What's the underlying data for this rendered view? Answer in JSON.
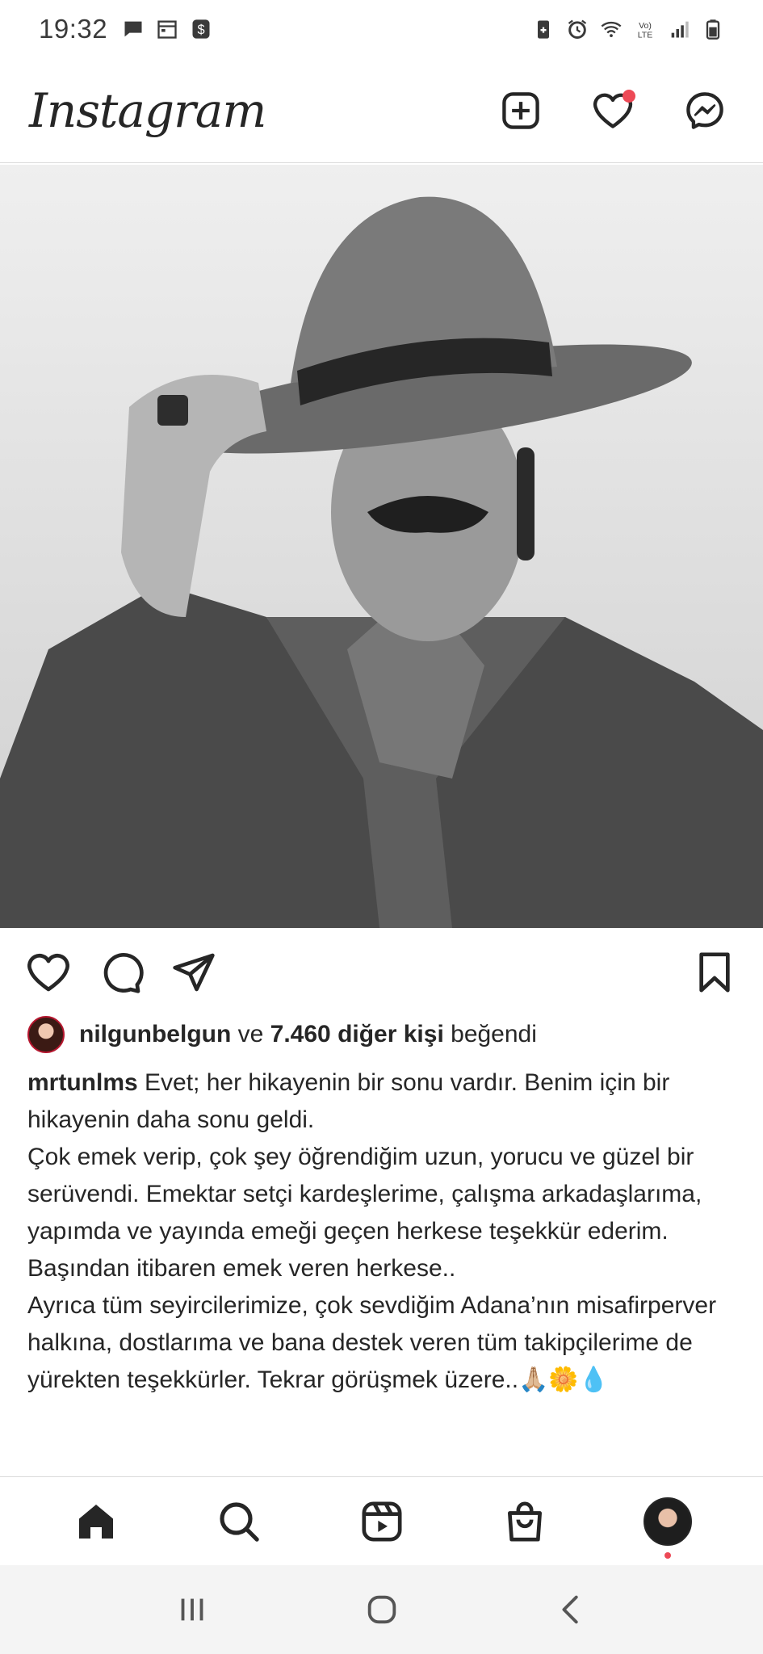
{
  "status_bar": {
    "time": "19:32",
    "left_icons": [
      "message-icon",
      "calendar-icon",
      "dollar-icon"
    ],
    "right_icons": [
      "save-battery-icon",
      "alarm-icon",
      "wifi-icon",
      "volte-icon",
      "signal-icon",
      "battery-icon"
    ]
  },
  "header": {
    "logo": "Instagram",
    "actions": [
      "new-post-icon",
      "heart-icon",
      "messenger-icon"
    ]
  },
  "post": {
    "image_alt": "post-photo",
    "actions": [
      "like-icon",
      "comment-icon",
      "share-icon",
      "save-icon"
    ],
    "likes": {
      "user": "nilgunbelgun",
      "connector": " ve ",
      "count_text": "7.460 diğer kişi",
      "suffix": " beğendi"
    },
    "caption": {
      "username": "mrtunlms",
      "line1": " Evet; her hikayenin bir sonu vardır. Benim için bir hikayenin daha sonu geldi.",
      "line2": "Çok emek verip, çok şey öğrendiğim uzun, yorucu ve güzel bir serüvendi. Emektar setçi kardeşlerime, çalışma arkadaşlarıma, yapımda ve yayında emeği geçen herkese teşekkür ederim. Başından itibaren emek veren herkese..",
      "line3": "Ayrıca tüm seyircilerimize, çok sevdiğim Adana’nın misafirperver halkına, dostlarıma ve bana destek veren tüm takipçilerime de yürekten teşekkürler. Tekrar görüşmek üzere..🙏🏼🌼💧"
    }
  },
  "bottom_nav": {
    "items": [
      "home-icon",
      "search-icon",
      "reels-icon",
      "shop-icon",
      "profile-avatar"
    ]
  },
  "system_nav": {
    "items": [
      "recents-icon",
      "home-button-icon",
      "back-icon"
    ]
  },
  "colors": {
    "notification": "#ed4956",
    "text": "#262626",
    "divider": "#dbdbdb"
  }
}
